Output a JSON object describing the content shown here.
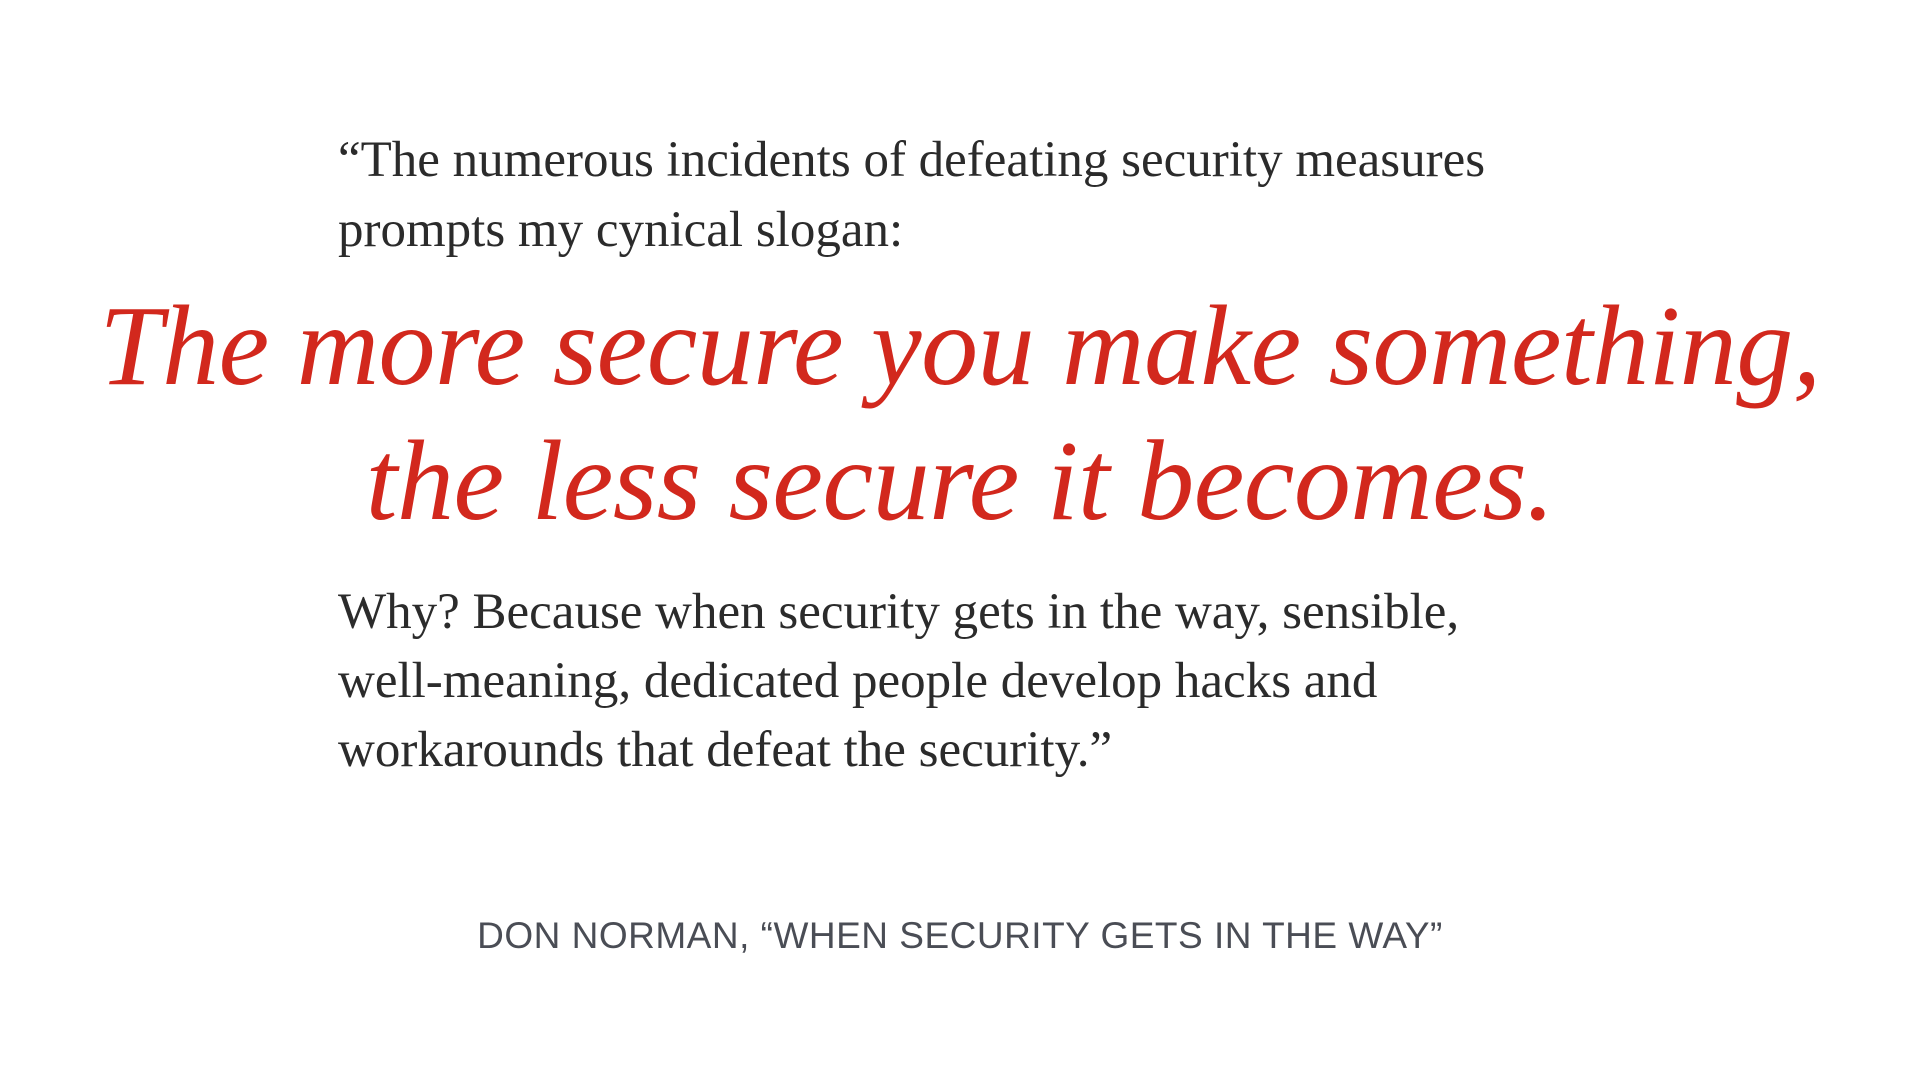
{
  "quote": {
    "intro_lines": [
      "“The numerous incidents of defeating security measures",
      "prompts my cynical slogan:"
    ],
    "slogan_lines": [
      "The more secure you make something,",
      "the less secure it becomes."
    ],
    "explanation_lines": [
      "Why? Because when security gets in the way, sensible,",
      "well-meaning, dedicated people develop hacks and",
      "workarounds that defeat the security.”"
    ]
  },
  "attribution": "DON NORMAN, “WHEN SECURITY GETS IN THE WAY”",
  "colors": {
    "slogan": "#d2281d",
    "body_text": "#2b2b2b",
    "attribution": "#4a4d55",
    "background": "#ffffff"
  }
}
